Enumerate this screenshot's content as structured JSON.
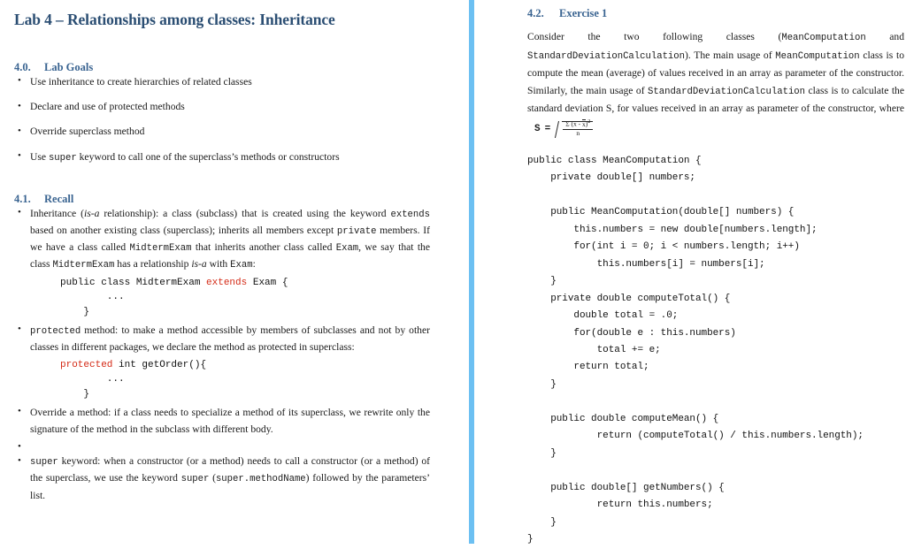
{
  "document": {
    "title": "Lab 4 – Relationships among classes: Inheritance",
    "accent_heading_color": "#3a6491",
    "title_color": "#2b4e73",
    "divider_color": "#6cc0f2",
    "keyword_color": "#d42a16"
  },
  "left_column": {
    "lab_goals": {
      "number": "4.0.",
      "title": "Lab Goals",
      "items": [
        "Use inheritance to create hierarchies of related classes",
        "Declare and use of protected methods",
        "Override superclass method",
        "Use super keyword to call one of the superclass's methods or constructors"
      ],
      "item4_prefix": "Use ",
      "item4_code": "super",
      "item4_suffix": " keyword to call one of the superclass’s methods or constructors"
    },
    "recall": {
      "number": "4.1.",
      "title": "Recall",
      "inheritance": {
        "seg1": "Inheritance (",
        "isa1": "is-a",
        "seg2": " relationship): a class (subclass) that is created using the keyword ",
        "code1": "extends",
        "seg3": " based on another existing class (superclass); inherits all members except ",
        "code2": "private",
        "seg4": " members. If we have a class called ",
        "code3": "MidtermExam",
        "seg5": " that inherits another class called ",
        "code4": "Exam",
        "seg6": ", we say that the class ",
        "code5": "MidtermExam",
        "seg7": " has a relationship ",
        "isa2": "is-a",
        "seg8": " with ",
        "code6": "Exam",
        "seg9": ":"
      },
      "snippet1_line1_a": "public class MidtermExam ",
      "snippet1_keyword": "extends",
      "snippet1_line1_b": " Exam {",
      "snippet1_line2": "        ...",
      "snippet1_line3": "    }",
      "protected": {
        "code1": "protected",
        "text": " method: to make a method accessible by members of subclasses and not by other classes in different packages, we declare the method as protected in superclass:"
      },
      "snippet2_keyword": "protected",
      "snippet2_line1_b": " int getOrder(){",
      "snippet2_line2": "        ...",
      "snippet2_line3": "    }",
      "override": "Override a method: if a class needs to specialize a method of its superclass, we rewrite only the signature of the method in the subclass with different body.",
      "super": {
        "code1": "super",
        "seg1": " keyword: when a constructor (or a method) needs to call a constructor (or a method) of the superclass, we use the keyword ",
        "code2": "super",
        "seg2": " (",
        "code3": "super.methodName",
        "seg3": ") followed by the parameters’ list."
      }
    }
  },
  "right_column": {
    "exercise": {
      "number": "4.2.",
      "title": "Exercise 1"
    },
    "paragraph": {
      "seg1": "Consider the two following classes (",
      "code1": "MeanComputation",
      "seg2": " and ",
      "code2": "StandardDeviationCalculation",
      "seg3": "). The main usage of ",
      "code3": "MeanComputation",
      "seg4": " class is to compute the mean (average) of values received in an array as parameter of the constructor. Similarly, the main usage of ",
      "code4": "StandardDeviationCalculation",
      "seg5": " class is to calculate the standard deviation S, for values received in an array as parameter of the constructor, where"
    },
    "formula": {
      "lhs": "S",
      "equals": "=",
      "numerator_sigma": "Σ",
      "numerator_body": "(x - x)",
      "numerator_exponent": "2",
      "denominator": "n"
    },
    "code": "public class MeanComputation {\n    private double[] numbers;\n\n    public MeanComputation(double[] numbers) {\n        this.numbers = new double[numbers.length];\n        for(int i = 0; i < numbers.length; i++)\n            this.numbers[i] = numbers[i];\n    }\n    private double computeTotal() {\n        double total = .0;\n        for(double e : this.numbers)\n            total += e;\n        return total;\n    }\n\n    public double computeMean() {\n            return (computeTotal() / this.numbers.length);\n    }\n\n    public double[] getNumbers() {\n            return this.numbers;\n    }\n}"
  }
}
